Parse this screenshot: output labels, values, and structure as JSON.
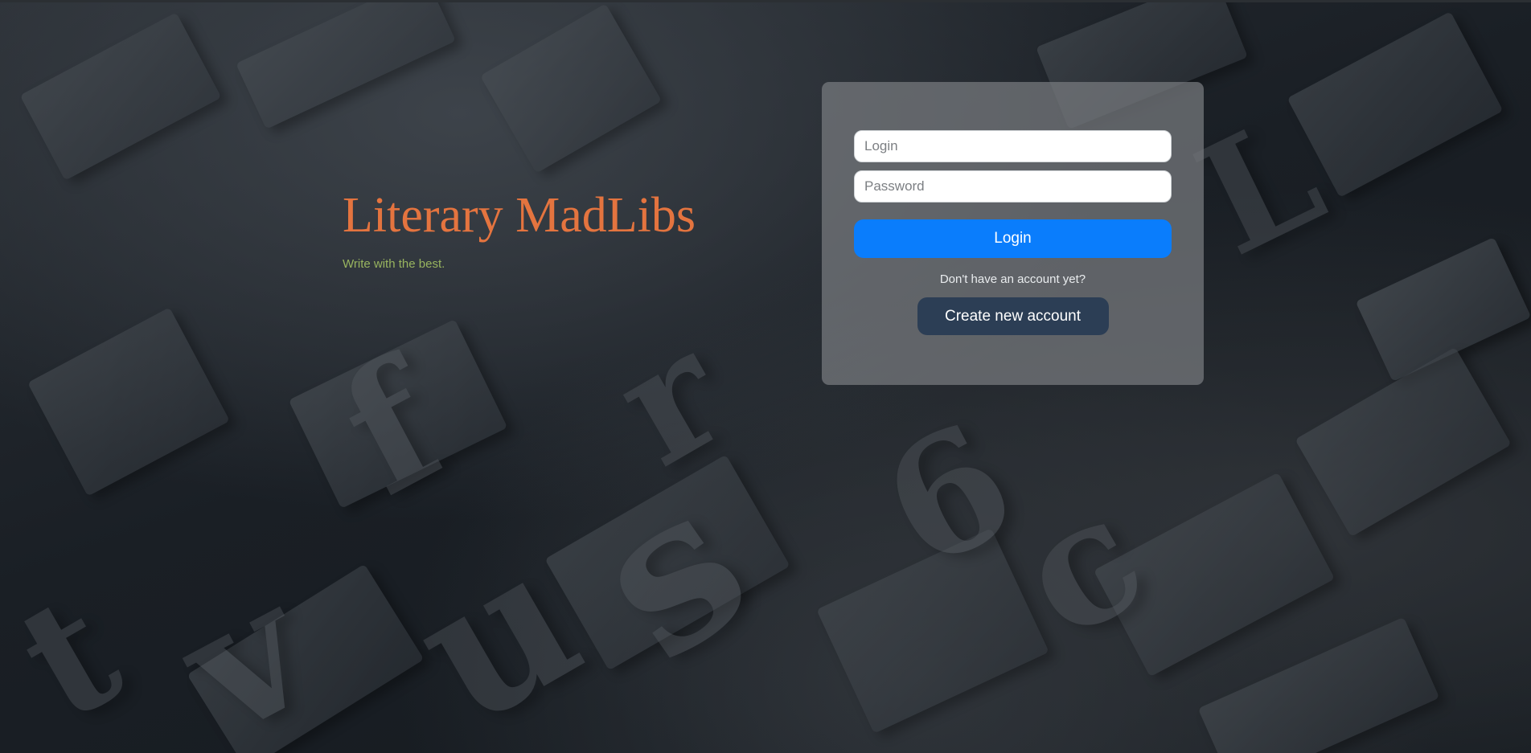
{
  "hero": {
    "title": "Literary MadLibs",
    "tagline": "Write with the best."
  },
  "login_form": {
    "login_placeholder": "Login",
    "password_placeholder": "Password",
    "login_button": "Login",
    "signup_prompt": "Don't have an account yet?",
    "create_account_button": "Create new account"
  },
  "colors": {
    "title": "#e4743f",
    "tagline": "#98b45f",
    "login_button": "#0a7dfc",
    "create_button": "#2c3e55"
  }
}
